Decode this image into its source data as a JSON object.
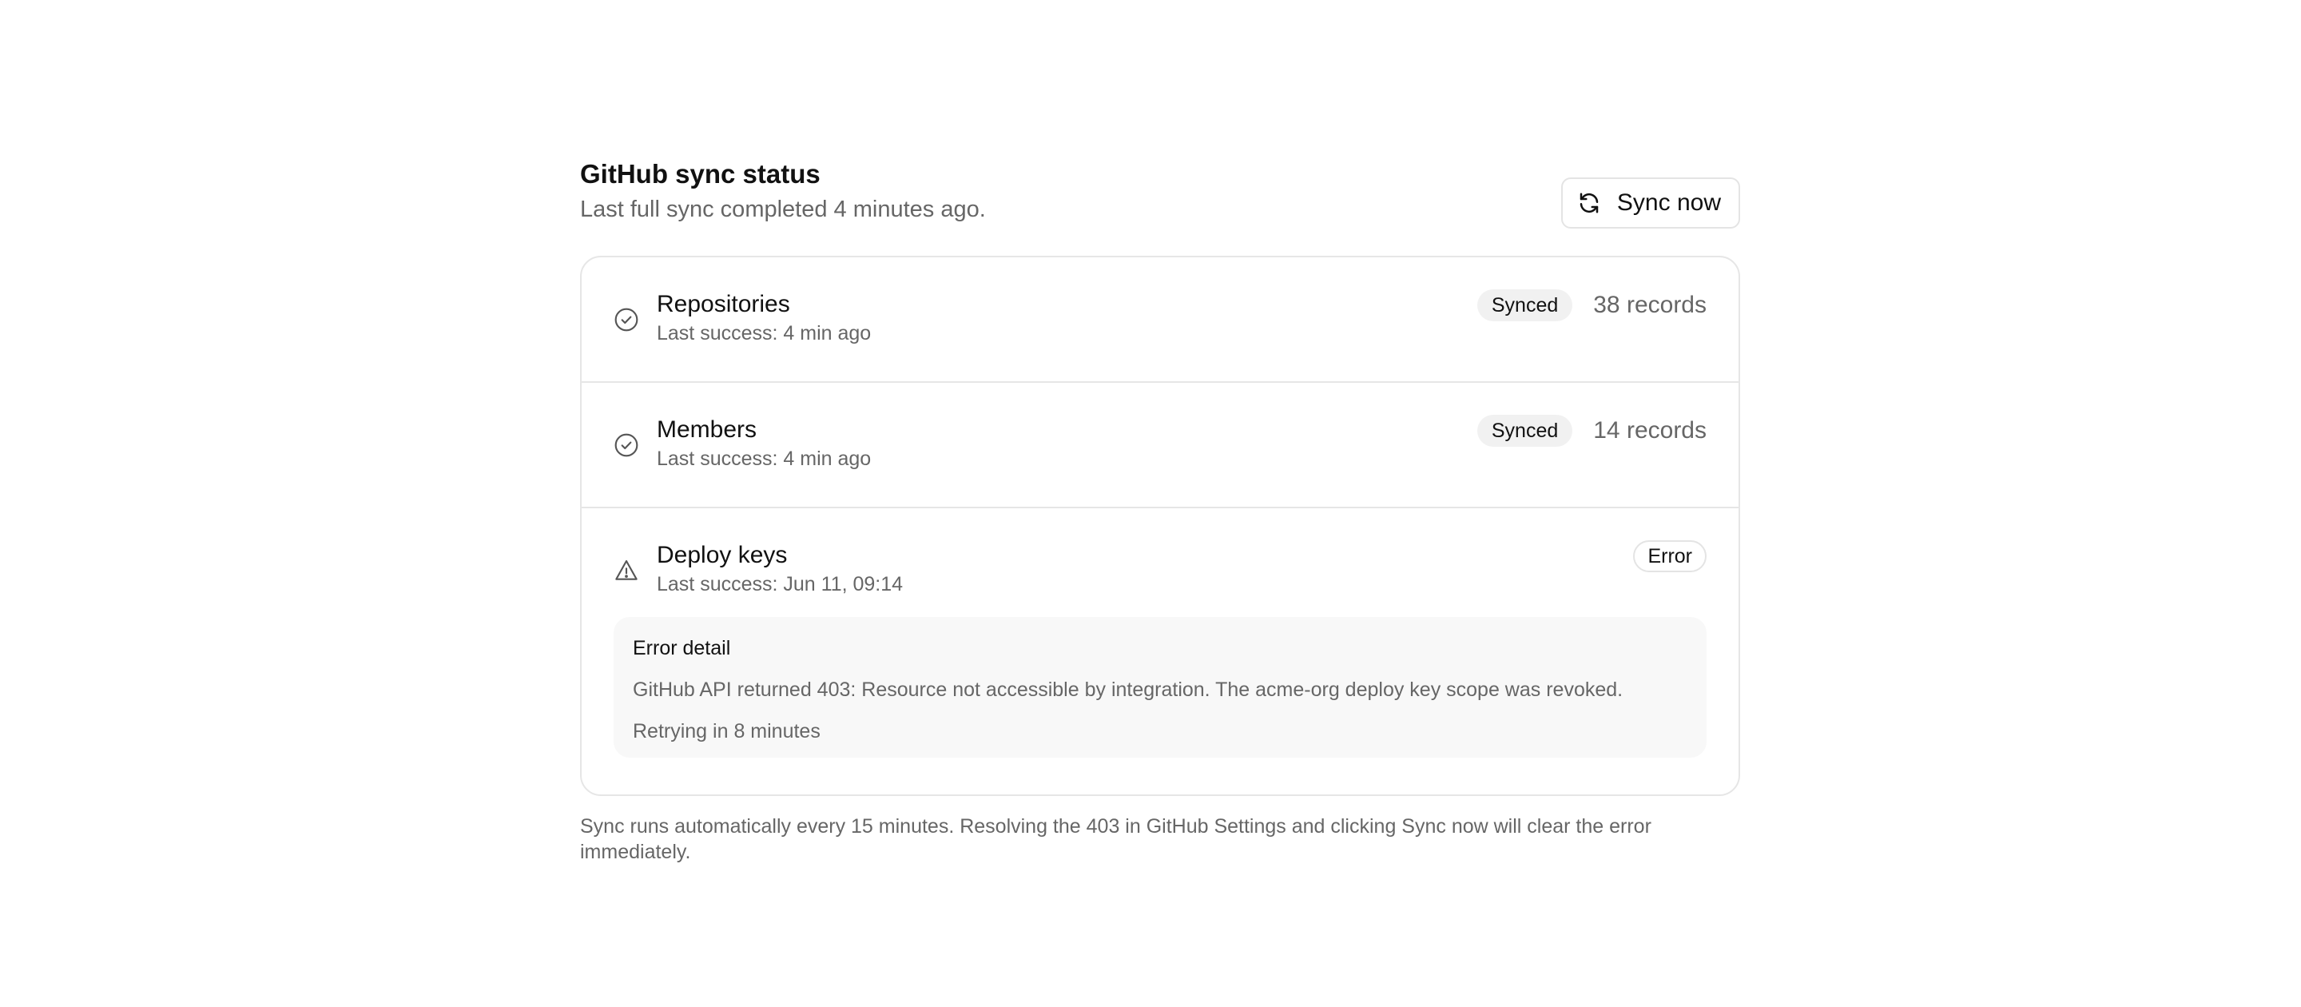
{
  "header": {
    "title": "GitHub sync status",
    "subtitle": "Last full sync completed 4 minutes ago.",
    "sync_button_label": "Sync now"
  },
  "resources": [
    {
      "name": "Repositories",
      "last_success": "Last success: 4 min ago",
      "status": "Synced",
      "records": "38 records",
      "icon": "check-circle-icon"
    },
    {
      "name": "Members",
      "last_success": "Last success: 4 min ago",
      "status": "Synced",
      "records": "14 records",
      "icon": "check-circle-icon"
    },
    {
      "name": "Deploy keys",
      "last_success": "Last success: Jun 11, 09:14",
      "status": "Error",
      "icon": "warning-triangle-icon",
      "error": {
        "title": "Error detail",
        "message": "GitHub API returned 403: Resource not accessible by integration. The acme-org deploy key scope was revoked.",
        "retry": "Retrying in 8 minutes"
      }
    }
  ],
  "footer": {
    "note": "Sync runs automatically every 15 minutes. Resolving the 403 in GitHub Settings and clicking Sync now will clear the error immediately."
  },
  "colors": {
    "text": "#111111",
    "muted": "#666666",
    "border": "#e6e6e6",
    "badge_bg": "#f1f1f1",
    "error_box_bg": "#f8f8f8"
  }
}
